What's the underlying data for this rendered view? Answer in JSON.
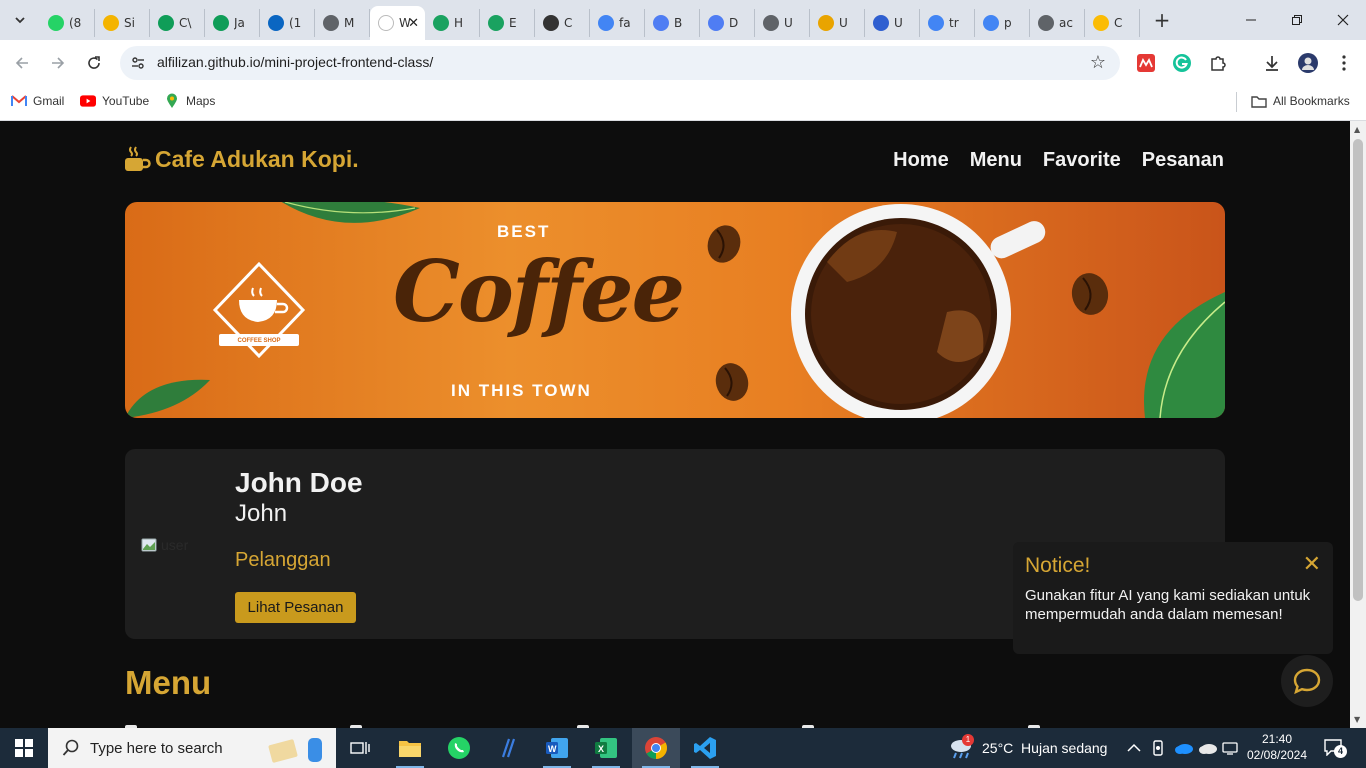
{
  "browser": {
    "tabs": [
      {
        "label": "(8",
        "icon": "whatsapp-icon",
        "color": "#25d366"
      },
      {
        "label": "Si",
        "icon": "google-drive-icon",
        "color": "#f4b400"
      },
      {
        "label": "C\\",
        "icon": "google-drive-icon",
        "color": "#0f9d58"
      },
      {
        "label": "Ja",
        "icon": "google-sheets-icon",
        "color": "#0f9d58"
      },
      {
        "label": "(1",
        "icon": "linkedin-icon",
        "color": "#0a66c2"
      },
      {
        "label": "M",
        "icon": "globe-icon",
        "color": "#5f6368"
      },
      {
        "label": "W",
        "icon": "page-icon",
        "color": "#ffffff",
        "active": true
      },
      {
        "label": "H",
        "icon": "webflow-icon",
        "color": "#1aa260"
      },
      {
        "label": "E",
        "icon": "webflow-icon",
        "color": "#1aa260"
      },
      {
        "label": "C",
        "icon": "chatgpt-icon",
        "color": "#333333"
      },
      {
        "label": "fa",
        "icon": "google-icon",
        "color": "#4285f4"
      },
      {
        "label": "B",
        "icon": "canva-icon",
        "color": "#4f7df3"
      },
      {
        "label": "D",
        "icon": "canva-icon",
        "color": "#4f7df3"
      },
      {
        "label": "U",
        "icon": "globe-icon",
        "color": "#5f6368"
      },
      {
        "label": "U",
        "icon": "graduation-icon",
        "color": "#e9a400"
      },
      {
        "label": "U",
        "icon": "dicoding-icon",
        "color": "#2f5fd0"
      },
      {
        "label": "tr",
        "icon": "google-icon",
        "color": "#4285f4"
      },
      {
        "label": "p",
        "icon": "google-icon",
        "color": "#4285f4"
      },
      {
        "label": "ac",
        "icon": "globe-icon",
        "color": "#5f6368"
      },
      {
        "label": "C",
        "icon": "google-photos-icon",
        "color": "#fbbc05"
      }
    ],
    "url": "alfilizan.github.io/mini-project-frontend-class/",
    "bookmarks": [
      {
        "label": "Gmail",
        "icon": "gmail-icon"
      },
      {
        "label": "YouTube",
        "icon": "youtube-icon"
      },
      {
        "label": "Maps",
        "icon": "maps-icon"
      }
    ],
    "all_bookmarks_label": "All Bookmarks"
  },
  "site": {
    "brand": "Cafe Adukan Kopi.",
    "nav": [
      "Home",
      "Menu",
      "Favorite",
      "Pesanan"
    ],
    "banner": {
      "top_text": "BEST",
      "main_text": "Coffee",
      "bottom_text": "IN THIS TOWN",
      "badge_text": "COFFEE SHOP"
    },
    "profile": {
      "name": "John Doe",
      "username": "John",
      "role": "Pelanggan",
      "button": "Lihat Pesanan",
      "avatar_alt": "user"
    },
    "menu_title": "Menu",
    "notice": {
      "title": "Notice!",
      "close": "✕",
      "body": "Gunakan fitur AI yang kami sediakan untuk mempermudah anda dalam memesan!"
    },
    "colors": {
      "accent": "#d6a634",
      "background": "#0d0d0d",
      "card": "#1e1e1e"
    }
  },
  "taskbar": {
    "search_placeholder": "Type here to search",
    "weather": "25°C  Hujan sedang",
    "weather_badge": "1",
    "time": "21:40",
    "date": "02/08/2024",
    "notifications": "4"
  }
}
